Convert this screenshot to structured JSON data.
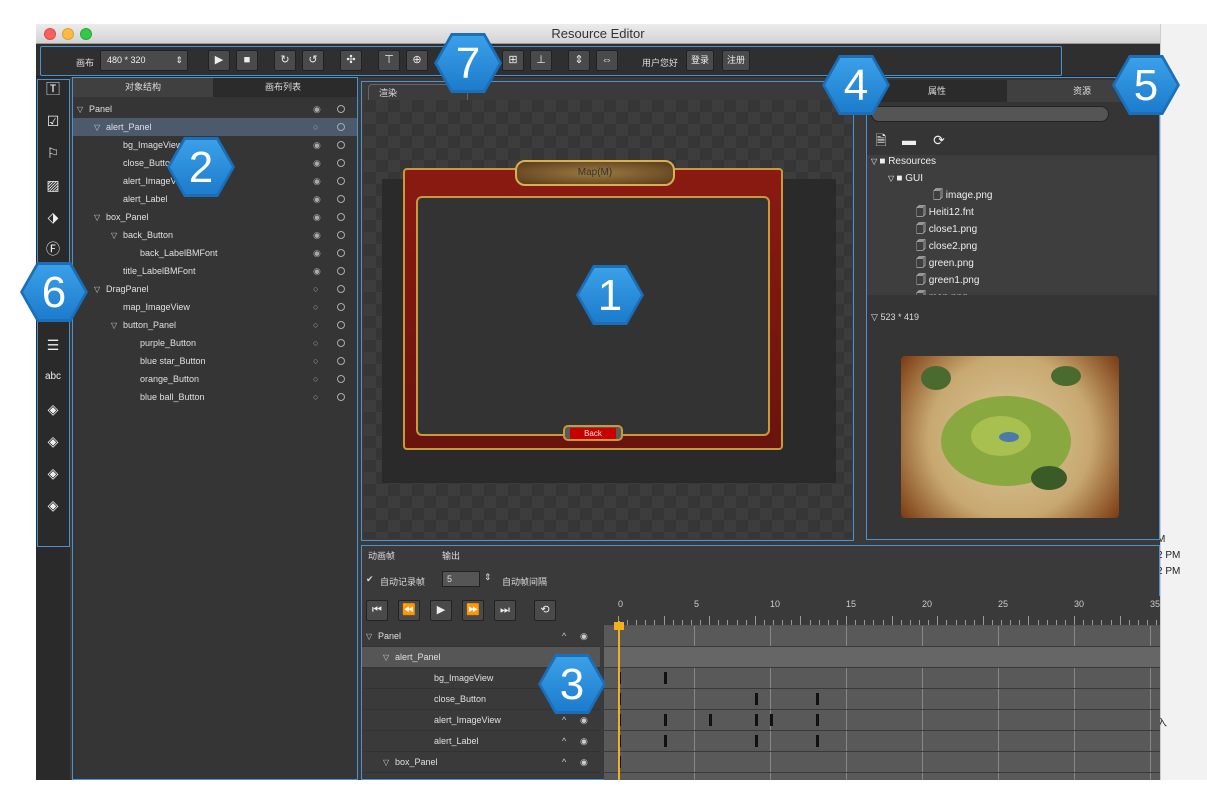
{
  "window": {
    "title": "Resource Editor"
  },
  "toolbar": {
    "canvas_label": "画布",
    "canvas_size": "480 * 320",
    "user_label": "用户您好",
    "login": "登录",
    "register": "注册"
  },
  "tree_panel": {
    "tabs": [
      "对象结构",
      "画布列表"
    ],
    "items": [
      {
        "label": "Panel",
        "indent": 0,
        "expanded": true,
        "eye": true
      },
      {
        "label": "alert_Panel",
        "indent": 1,
        "expanded": true,
        "selected": true,
        "eye": false
      },
      {
        "label": "bg_ImageView",
        "indent": 2,
        "eye": true
      },
      {
        "label": "close_Button",
        "indent": 2,
        "eye": true
      },
      {
        "label": "alert_ImageView",
        "indent": 2,
        "eye": true
      },
      {
        "label": "alert_Label",
        "indent": 2,
        "eye": true
      },
      {
        "label": "box_Panel",
        "indent": 1,
        "expanded": true,
        "eye": true
      },
      {
        "label": "back_Button",
        "indent": 2,
        "expanded": true,
        "eye": true
      },
      {
        "label": "back_LabelBMFont",
        "indent": 3,
        "eye": true
      },
      {
        "label": "title_LabelBMFont",
        "indent": 2,
        "eye": true
      },
      {
        "label": "DragPanel",
        "indent": 1,
        "expanded": true,
        "eye": false
      },
      {
        "label": "map_ImageView",
        "indent": 2,
        "eye": false
      },
      {
        "label": "button_Panel",
        "indent": 2,
        "expanded": true,
        "eye": false
      },
      {
        "label": "purple_Button",
        "indent": 3,
        "eye": false
      },
      {
        "label": "blue star_Button",
        "indent": 3,
        "eye": false
      },
      {
        "label": "orange_Button",
        "indent": 3,
        "eye": false
      },
      {
        "label": "blue ball_Button",
        "indent": 3,
        "eye": false
      }
    ]
  },
  "render": {
    "tab": "渲染",
    "frame_title": "Map(M)",
    "back_button": "Back"
  },
  "right_panel": {
    "tabs": [
      "属性",
      "资源"
    ],
    "resources": [
      {
        "label": "Resources",
        "indent": 0,
        "type": "folder"
      },
      {
        "label": "GUI",
        "indent": 1,
        "type": "folder"
      },
      {
        "label": "image.png",
        "indent": 2,
        "type": "file"
      },
      {
        "label": "Heiti12.fnt",
        "indent": 1,
        "type": "file"
      },
      {
        "label": "close1.png",
        "indent": 1,
        "type": "file"
      },
      {
        "label": "close2.png",
        "indent": 1,
        "type": "file"
      },
      {
        "label": "green.png",
        "indent": 1,
        "type": "file"
      },
      {
        "label": "green1.png",
        "indent": 1,
        "type": "file"
      },
      {
        "label": "map.png",
        "indent": 1,
        "type": "file"
      }
    ],
    "preview_size": "523 * 419"
  },
  "animation": {
    "tabs": [
      "动画帧",
      "输出"
    ],
    "auto_record_label": "自动记录帧",
    "frame_value": "5",
    "interval_label": "自动帧间隔",
    "ruler_labels": [
      "0",
      "5",
      "10",
      "15",
      "20",
      "25",
      "30",
      "35"
    ],
    "current_frame": 0,
    "rows": [
      {
        "label": "Panel",
        "indent": 0,
        "expanded": true,
        "keys": []
      },
      {
        "label": "alert_Panel",
        "indent": 1,
        "expanded": true,
        "selected": true,
        "keys": []
      },
      {
        "label": "bg_ImageView",
        "indent": 2,
        "keys": [
          0,
          15
        ]
      },
      {
        "label": "close_Button",
        "indent": 2,
        "keys": [
          0,
          45,
          65
        ]
      },
      {
        "label": "alert_ImageView",
        "indent": 2,
        "keys": [
          0,
          15,
          30,
          45,
          50,
          65
        ]
      },
      {
        "label": "alert_Label",
        "indent": 2,
        "keys": [
          0,
          15,
          45,
          65
        ]
      },
      {
        "label": "box_Panel",
        "indent": 1,
        "expanded": true,
        "keys": [
          0
        ]
      }
    ]
  },
  "callouts": [
    "1",
    "2",
    "3",
    "4",
    "5",
    "6",
    "7"
  ],
  "background_fragments": [
    "M",
    "2 PM",
    "2 PM",
    "入"
  ]
}
